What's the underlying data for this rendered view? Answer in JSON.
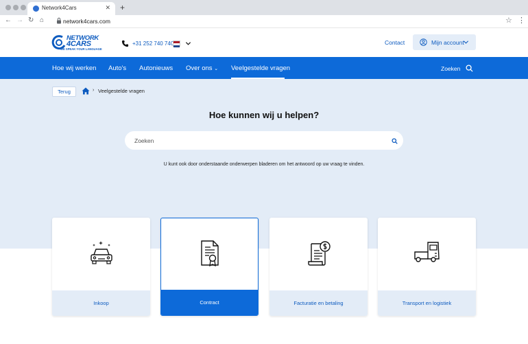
{
  "browser": {
    "tab_title": "Network4Cars",
    "url": "network4cars.com"
  },
  "header": {
    "logo_line1": "NETWORK",
    "logo_line2": "4CARS",
    "logo_tagline": "WE SPEAK YOUR LANGUAGE",
    "phone": "+31 252 740 740",
    "contact_label": "Contact",
    "account_label": "Mijn account"
  },
  "nav": {
    "items": [
      "Hoe wij werken",
      "Auto's",
      "Autonieuws",
      "Over ons",
      "Veelgestelde vragen"
    ],
    "active": "Veelgestelde vragen",
    "search_label": "Zoeken"
  },
  "breadcrumb": {
    "back_label": "Terug",
    "current": "Veelgestelde vragen"
  },
  "hero": {
    "title": "Hoe kunnen wij u helpen?",
    "search_placeholder": "Zoeken",
    "hint": "U kunt ook door onderstaande onderwerpen bladeren om het antwoord op uw vraag te vinden."
  },
  "categories": [
    {
      "label": "Inkoop",
      "icon": "car-sparkle-icon",
      "active": false
    },
    {
      "label": "Contract",
      "icon": "certificate-document-icon",
      "active": true
    },
    {
      "label": "Facturatie en betaling",
      "icon": "invoice-dollar-icon",
      "active": false
    },
    {
      "label": "Transport en logistiek",
      "icon": "truck-icon",
      "active": false
    }
  ],
  "colors": {
    "brand_blue": "#0d6ad9",
    "hero_bg": "#e3ecf7"
  }
}
